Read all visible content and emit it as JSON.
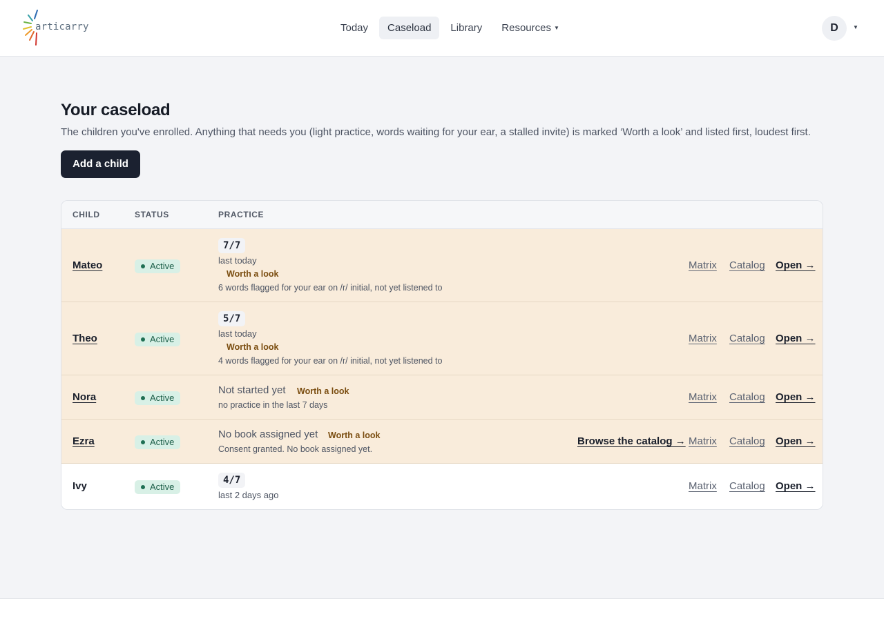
{
  "header": {
    "logo_text": "articarry",
    "nav": [
      {
        "label": "Today"
      },
      {
        "label": "Caseload"
      },
      {
        "label": "Library"
      },
      {
        "label": "Resources"
      }
    ],
    "current_nav": "Caseload",
    "avatar_initial": "D"
  },
  "intro": {
    "title": "Your caseload",
    "description": "The children you've enrolled. Anything that needs you (light practice, words waiting for your ear, a stalled invite) is marked ‘Worth a look’ and listed first, loudest first.",
    "add_button": "Add a child"
  },
  "table": {
    "headers": {
      "child": "CHILD",
      "status": "STATUS",
      "practice": "PRACTICE"
    },
    "rows": [
      {
        "name": "Mateo",
        "status": "Active",
        "score": "7/7",
        "last": "last today",
        "flag": "Worth a look",
        "note": "6 words flagged for your ear on /r/ initial, not yet listened to"
      },
      {
        "name": "Theo",
        "status": "Active",
        "score": "5/7",
        "last": "last today",
        "flag": "Worth a look",
        "note": "4 words flagged for your ear on /r/ initial, not yet listened to"
      },
      {
        "name": "Nora",
        "status": "Active",
        "state": "Not started yet",
        "flag": "Worth a look",
        "note": "no practice in the last 7 days"
      },
      {
        "name": "Ezra",
        "status": "Active",
        "state": "No book assigned yet",
        "flag": "Worth a look",
        "note": "Consent granted. No book assigned yet.",
        "browse_link": "Browse the catalog →"
      },
      {
        "name": "Ivy",
        "status": "Active",
        "score": "4/7",
        "last": "last 2 days ago"
      }
    ],
    "row_links": {
      "matrix": "Matrix",
      "catalog": "Catalog",
      "open": "Open →"
    }
  },
  "colors": {
    "flag_row_bg": "#f9ecdb",
    "worth_text": "#7a4d10",
    "status_badge_bg": "#d8f0e6",
    "primary_button": "#1b2130"
  }
}
